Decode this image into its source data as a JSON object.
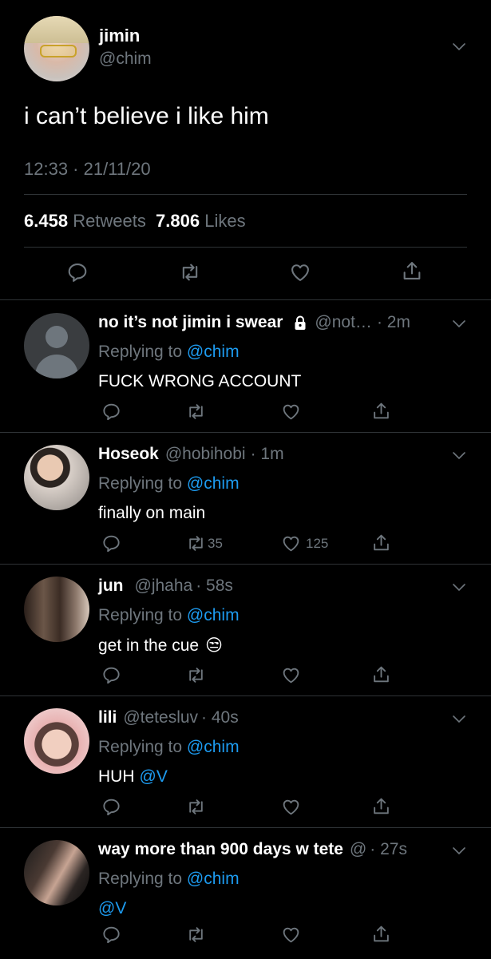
{
  "main_tweet": {
    "display_name": "jimin",
    "handle": "@chim",
    "text": "i can’t believe i like him",
    "timestamp": "12:33 · 21/11/20",
    "retweet_count": "6.458",
    "retweet_label": "Retweets",
    "like_count": "7.806",
    "like_label": "Likes"
  },
  "replies": [
    {
      "display_name": "no it’s not jimin i swear",
      "handle": "@not…",
      "time": "· 2m",
      "protected": true,
      "replying_prefix": "Replying to",
      "replying_to": "@chim",
      "text": "FUCK WRONG ACCOUNT",
      "retweets": "",
      "likes": ""
    },
    {
      "display_name": "Hoseok",
      "handle": "@hobihobi",
      "time": "· 1m",
      "replying_prefix": "Replying to",
      "replying_to": "@chim",
      "text": "finally on main",
      "retweets": "35",
      "likes": "125"
    },
    {
      "display_name": "jun",
      "handle": "@jhaha",
      "time": "· 58s",
      "replying_prefix": "Replying to",
      "replying_to": "@chim",
      "text": "get in the cue",
      "emoji": "😒",
      "retweets": "",
      "likes": ""
    },
    {
      "display_name": "lili",
      "handle": "@tetesluv",
      "time": "· 40s",
      "replying_prefix": "Replying to",
      "replying_to": "@chim",
      "text": "HUH",
      "mention": "@V",
      "retweets": "",
      "likes": ""
    },
    {
      "display_name": "way more than 900 days w tete",
      "handle": "@",
      "time": "· 27s",
      "replying_prefix": "Replying to",
      "replying_to": "@chim",
      "text": "",
      "mention": "@V",
      "retweets": "",
      "likes": ""
    }
  ],
  "colors": {
    "background": "#000000",
    "muted": "#6e767d",
    "link": "#1d9bf0",
    "divider": "#2f3336"
  },
  "icons": [
    "reply-icon",
    "retweet-icon",
    "like-icon",
    "share-icon",
    "chevron-down-icon",
    "lock-icon"
  ]
}
